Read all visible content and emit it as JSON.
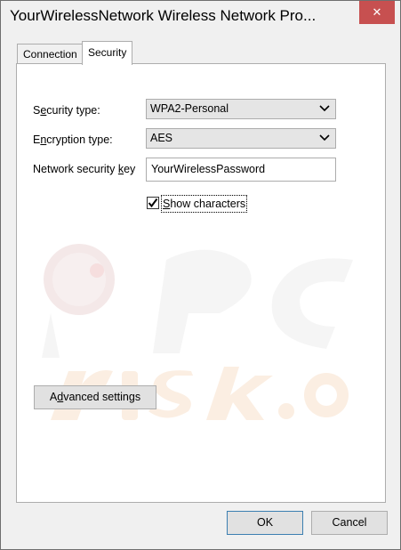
{
  "window": {
    "title": "YourWirelessNetwork Wireless Network Pro...",
    "close_glyph": "✕"
  },
  "tabs": [
    {
      "label": "Connection",
      "active": false
    },
    {
      "label": "Security",
      "active": true
    }
  ],
  "security": {
    "type_label_pre": "S",
    "type_label_key": "e",
    "type_label_post": "curity type:",
    "type_value": "WPA2-Personal",
    "encryption_label_pre": "E",
    "encryption_label_key": "n",
    "encryption_label_post": "cryption type:",
    "encryption_value": "AES",
    "key_label_pre": "Network security ",
    "key_label_key": "k",
    "key_label_post": "ey",
    "key_value": "YourWirelessPassword",
    "show_chars_key": "S",
    "show_chars_post": "how characters",
    "show_chars_checked": true
  },
  "buttons": {
    "advanced_pre": "A",
    "advanced_key": "d",
    "advanced_post": "vanced settings",
    "ok": "OK",
    "cancel": "Cancel"
  },
  "colors": {
    "close_button": "#c75050",
    "ok_border": "#3c7fb1"
  },
  "icons": {
    "close": "close-icon",
    "dropdown": "chevron-down-icon",
    "check": "checkmark-icon"
  }
}
